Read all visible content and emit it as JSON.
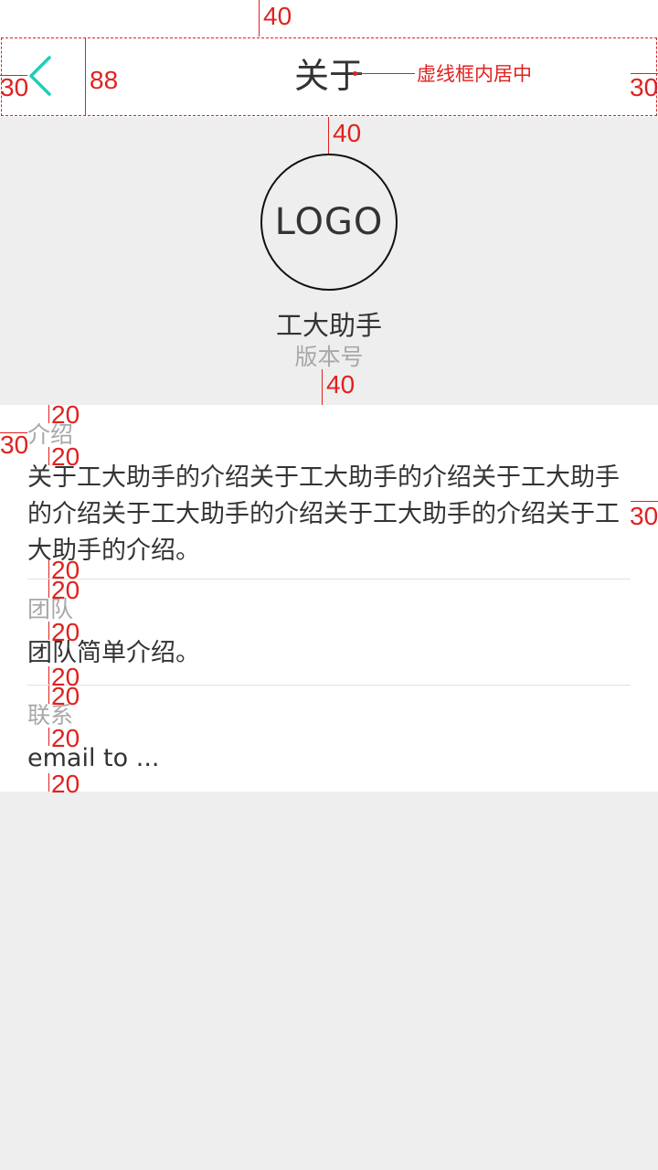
{
  "navbar": {
    "title": "关于",
    "back_icon": "chevron-left-icon",
    "accent_color": "#1ecfb8"
  },
  "header": {
    "logo_text": "LOGO",
    "app_name": "工大助手",
    "version_label": "版本号"
  },
  "sections": [
    {
      "label": "介绍",
      "body": "关于工大助手的介绍关于工大助手的介绍关于工大助手的介绍关于工大助手的介绍关于工大助手的介绍关于工大助手的介绍。"
    },
    {
      "label": "团队",
      "body": "团队简单介绍。"
    },
    {
      "label": "联系",
      "body": "email to ..."
    }
  ],
  "annotations": {
    "top_margin": "40",
    "nav_height": "88",
    "nav_left_padding": "30",
    "nav_right_padding": "30",
    "title_note": "虚线框内居中",
    "logo_gap": "40",
    "header_bottom_gap": "40",
    "card_left_padding": "30",
    "card_right_padding": "30",
    "spacing_20": "20",
    "color": "#e0221f"
  }
}
